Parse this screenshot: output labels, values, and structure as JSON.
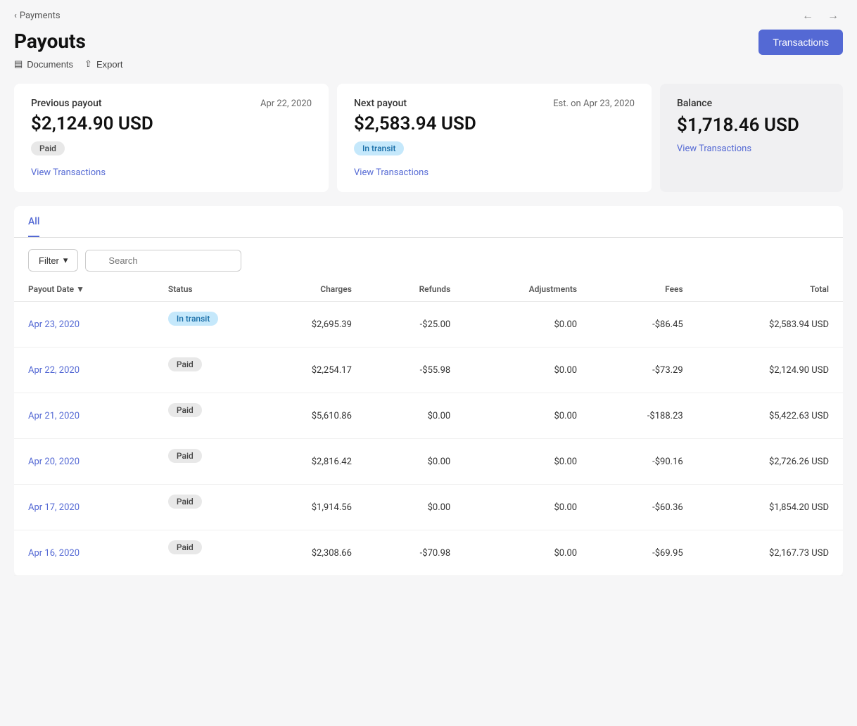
{
  "nav": {
    "back_label": "Payments",
    "back_arrow": "‹",
    "arrow_left": "←",
    "arrow_right": "→"
  },
  "header": {
    "title": "Payouts",
    "documents_label": "Documents",
    "export_label": "Export",
    "transactions_label": "Transactions"
  },
  "cards": {
    "previous": {
      "label": "Previous payout",
      "date": "Apr 22, 2020",
      "amount": "$2,124.90 USD",
      "badge": "Paid",
      "view_link": "View Transactions"
    },
    "next": {
      "label": "Next payout",
      "date": "Est. on Apr 23, 2020",
      "amount": "$2,583.94 USD",
      "badge": "In transit",
      "view_link": "View Transactions"
    },
    "balance": {
      "label": "Balance",
      "amount": "$1,718.46 USD",
      "view_link": "View Transactions"
    }
  },
  "tabs": [
    {
      "label": "All",
      "active": true
    }
  ],
  "filter": {
    "filter_label": "Filter",
    "search_placeholder": "Search"
  },
  "table": {
    "columns": [
      {
        "key": "payout_date",
        "label": "Payout Date ▼",
        "align": "left"
      },
      {
        "key": "status",
        "label": "Status",
        "align": "left"
      },
      {
        "key": "charges",
        "label": "Charges",
        "align": "right"
      },
      {
        "key": "refunds",
        "label": "Refunds",
        "align": "right"
      },
      {
        "key": "adjustments",
        "label": "Adjustments",
        "align": "right"
      },
      {
        "key": "fees",
        "label": "Fees",
        "align": "right"
      },
      {
        "key": "total",
        "label": "Total",
        "align": "right"
      }
    ],
    "rows": [
      {
        "date": "Apr 23, 2020",
        "status": "In transit",
        "status_type": "transit",
        "charges": "$2,695.39",
        "refunds": "-$25.00",
        "adjustments": "$0.00",
        "fees": "-$86.45",
        "total": "$2,583.94 USD"
      },
      {
        "date": "Apr 22, 2020",
        "status": "Paid",
        "status_type": "paid",
        "charges": "$2,254.17",
        "refunds": "-$55.98",
        "adjustments": "$0.00",
        "fees": "-$73.29",
        "total": "$2,124.90 USD"
      },
      {
        "date": "Apr 21, 2020",
        "status": "Paid",
        "status_type": "paid",
        "charges": "$5,610.86",
        "refunds": "$0.00",
        "adjustments": "$0.00",
        "fees": "-$188.23",
        "total": "$5,422.63 USD"
      },
      {
        "date": "Apr 20, 2020",
        "status": "Paid",
        "status_type": "paid",
        "charges": "$2,816.42",
        "refunds": "$0.00",
        "adjustments": "$0.00",
        "fees": "-$90.16",
        "total": "$2,726.26 USD"
      },
      {
        "date": "Apr 17, 2020",
        "status": "Paid",
        "status_type": "paid",
        "charges": "$1,914.56",
        "refunds": "$0.00",
        "adjustments": "$0.00",
        "fees": "-$60.36",
        "total": "$1,854.20 USD"
      },
      {
        "date": "Apr 16, 2020",
        "status": "Paid",
        "status_type": "paid",
        "charges": "$2,308.66",
        "refunds": "-$70.98",
        "adjustments": "$0.00",
        "fees": "-$69.95",
        "total": "$2,167.73 USD"
      }
    ]
  }
}
